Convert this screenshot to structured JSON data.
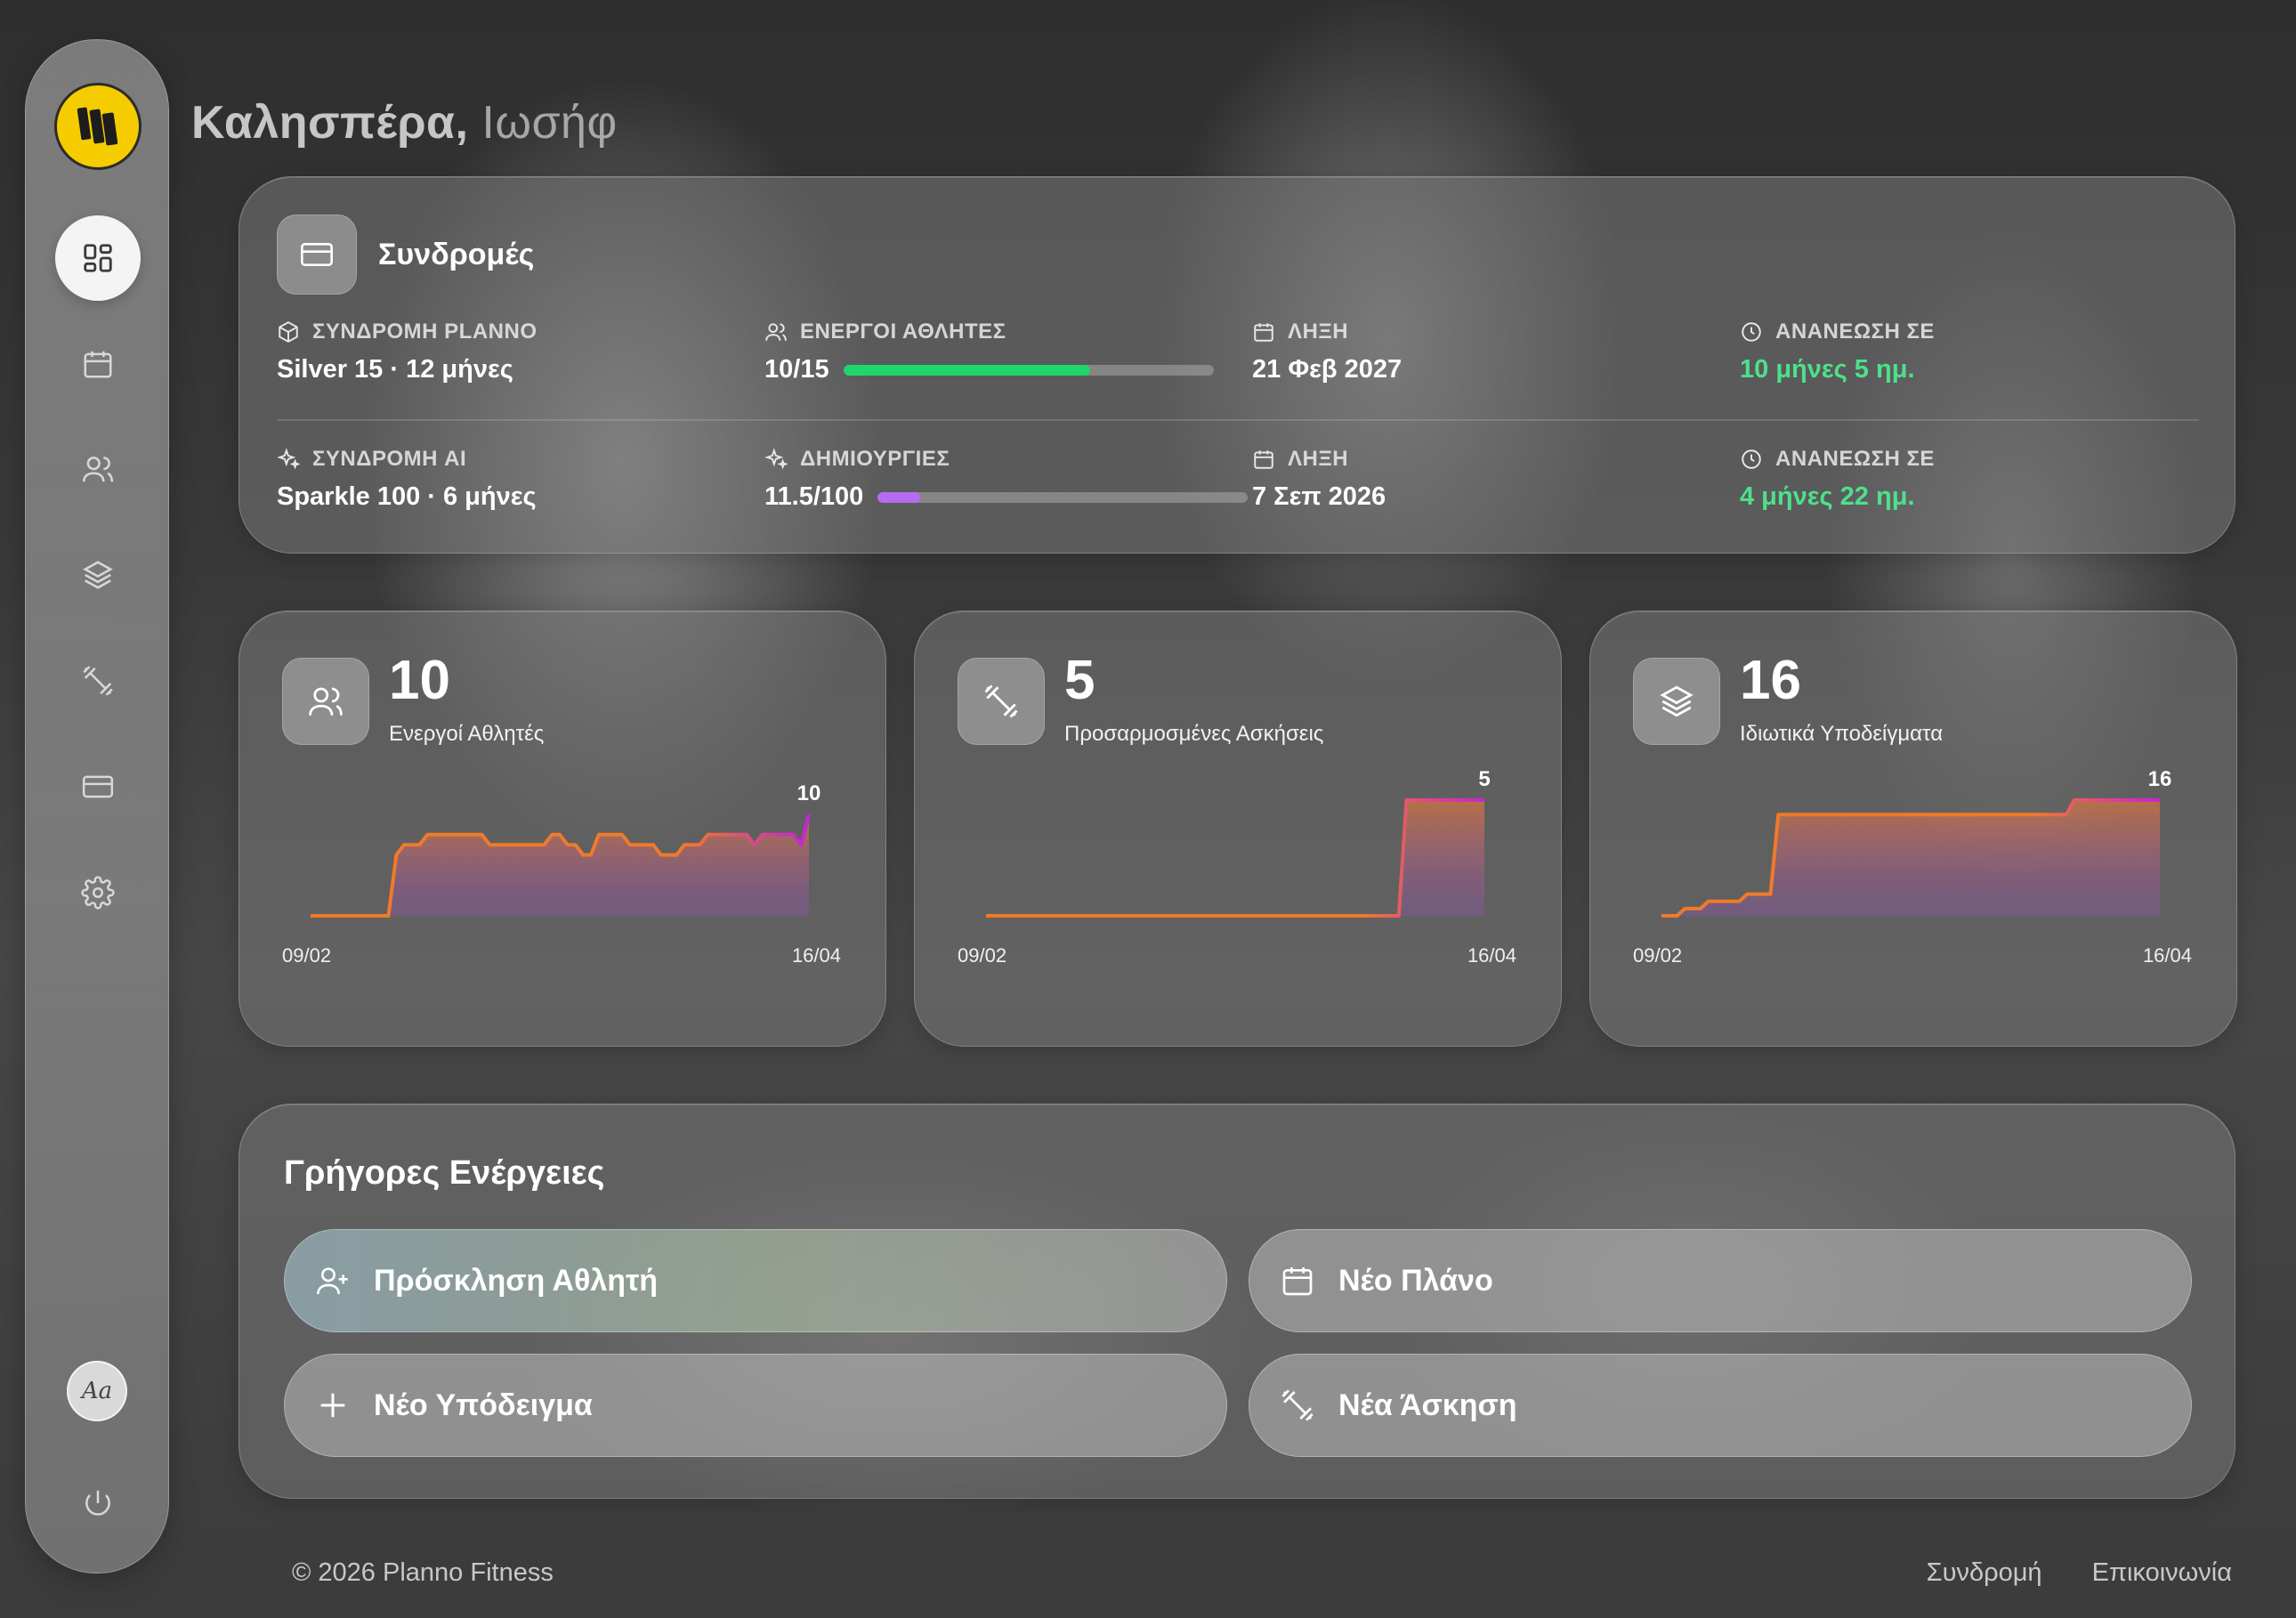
{
  "greeting": {
    "prefix": "Καλησπέρα,",
    "name": "Ιωσήφ"
  },
  "sidebar": {
    "items": [
      {
        "name": "dashboard",
        "icon": "dashboard-icon",
        "active": true
      },
      {
        "name": "calendar",
        "icon": "calendar-icon"
      },
      {
        "name": "athletes",
        "icon": "users-icon"
      },
      {
        "name": "templates",
        "icon": "layers-icon"
      },
      {
        "name": "exercises",
        "icon": "dumbbell-icon"
      },
      {
        "name": "billing",
        "icon": "credit-card-icon"
      },
      {
        "name": "settings",
        "icon": "gear-icon"
      }
    ],
    "font_button": "Aa"
  },
  "subscriptions": {
    "title": "Συνδρομές",
    "rows": [
      {
        "plan_label": "ΣΥΝΔΡΟΜΗ PLANNO",
        "plan_value": "Silver 15 · 12 μήνες",
        "usage_label": "ΕΝΕΡΓΟΙ ΑΘΛΗΤΕΣ",
        "usage_value": "10/15",
        "usage_fraction": 0.667,
        "usage_color": "#1fd66b",
        "expiry_label": "ΛΗΞΗ",
        "expiry_value": "21 Φεβ 2027",
        "renew_label": "ΑΝΑΝΕΩΣΗ ΣΕ",
        "renew_value": "10 μήνες 5 ημ."
      },
      {
        "plan_label": "ΣΥΝΔΡΟΜΗ AI",
        "plan_value": "Sparkle 100 · 6 μήνες",
        "usage_label": "ΔΗΜΙΟΥΡΓΙΕΣ",
        "usage_value": "11.5/100",
        "usage_fraction": 0.115,
        "usage_color": "#b66cf0",
        "expiry_label": "ΛΗΞΗ",
        "expiry_value": "7 Σεπ 2026",
        "renew_label": "ΑΝΑΝΕΩΣΗ ΣΕ",
        "renew_value": "4 μήνες 22 ημ."
      }
    ]
  },
  "stats": [
    {
      "value": "10",
      "caption": "Ενεργοί Αθλητές",
      "icon": "users-icon",
      "x_start": "09/02",
      "x_end": "16/04",
      "end_label": "10"
    },
    {
      "value": "5",
      "caption": "Προσαρμοσμένες Ασκήσεις",
      "icon": "dumbbell-icon",
      "x_start": "09/02",
      "x_end": "16/04",
      "end_label": "5"
    },
    {
      "value": "16",
      "caption": "Ιδιωτικά Υποδείγματα",
      "icon": "layers-icon",
      "x_start": "09/02",
      "x_end": "16/04",
      "end_label": "16"
    }
  ],
  "chart_data": [
    {
      "type": "area",
      "title": "Ενεργοί Αθλητές",
      "x_range": [
        "09/02",
        "16/04"
      ],
      "values": [
        0,
        0,
        0,
        0,
        0,
        0,
        0,
        0,
        0,
        0,
        0,
        6,
        7,
        7,
        7,
        8,
        8,
        8,
        8,
        8,
        8,
        8,
        8,
        7,
        7,
        7,
        7,
        7,
        7,
        7,
        7,
        8,
        8,
        7,
        7,
        6,
        6,
        8,
        8,
        8,
        8,
        7,
        7,
        7,
        7,
        6,
        6,
        6,
        7,
        7,
        7,
        8,
        8,
        8,
        8,
        8,
        8,
        7,
        8,
        8,
        8,
        8,
        8,
        7,
        10
      ],
      "ylim": [
        0,
        10
      ],
      "end_label": "10"
    },
    {
      "type": "area",
      "title": "Προσαρμοσμένες Ασκήσεις",
      "x_range": [
        "09/02",
        "16/04"
      ],
      "values": [
        0,
        0,
        0,
        0,
        0,
        0,
        0,
        0,
        0,
        0,
        0,
        0,
        0,
        0,
        0,
        0,
        0,
        0,
        0,
        0,
        0,
        0,
        0,
        0,
        0,
        0,
        0,
        0,
        0,
        0,
        0,
        0,
        0,
        0,
        0,
        0,
        0,
        0,
        0,
        0,
        0,
        0,
        0,
        0,
        0,
        0,
        0,
        0,
        0,
        0,
        0,
        0,
        0,
        0,
        5,
        5,
        5,
        5,
        5,
        5,
        5,
        5,
        5,
        5,
        5
      ],
      "ylim": [
        0,
        5
      ],
      "end_label": "5"
    },
    {
      "type": "area",
      "title": "Ιδιωτικά Υποδείγματα",
      "x_range": [
        "09/02",
        "16/04"
      ],
      "values": [
        0,
        0,
        0,
        1,
        1,
        1,
        2,
        2,
        2,
        2,
        2,
        3,
        3,
        3,
        3,
        14,
        14,
        14,
        14,
        14,
        14,
        14,
        14,
        14,
        14,
        14,
        14,
        14,
        14,
        14,
        14,
        14,
        14,
        14,
        14,
        14,
        14,
        14,
        14,
        14,
        14,
        14,
        14,
        14,
        14,
        14,
        14,
        14,
        14,
        14,
        14,
        14,
        14,
        16,
        16,
        16,
        16,
        16,
        16,
        16,
        16,
        16,
        16,
        16,
        16
      ],
      "ylim": [
        0,
        16
      ],
      "end_label": "16"
    }
  ],
  "quick_actions": {
    "title": "Γρήγορες Ενέργειες",
    "buttons": [
      {
        "label": "Πρόσκληση Αθλητή",
        "icon": "user-plus-icon"
      },
      {
        "label": "Νέο Πλάνο",
        "icon": "calendar-icon"
      },
      {
        "label": "Νέο Υπόδειγμα",
        "icon": "plus-icon"
      },
      {
        "label": "Νέα Άσκηση",
        "icon": "dumbbell-icon"
      }
    ]
  },
  "footer": {
    "copyright": "© 2026 Planno Fitness",
    "links": [
      "Συνδρομή",
      "Επικοινωνία"
    ]
  },
  "colors": {
    "accent_logo": "#f5cc00",
    "line_start": "#f07a2a",
    "line_end": "#c424d4",
    "success": "#4ee08a"
  }
}
